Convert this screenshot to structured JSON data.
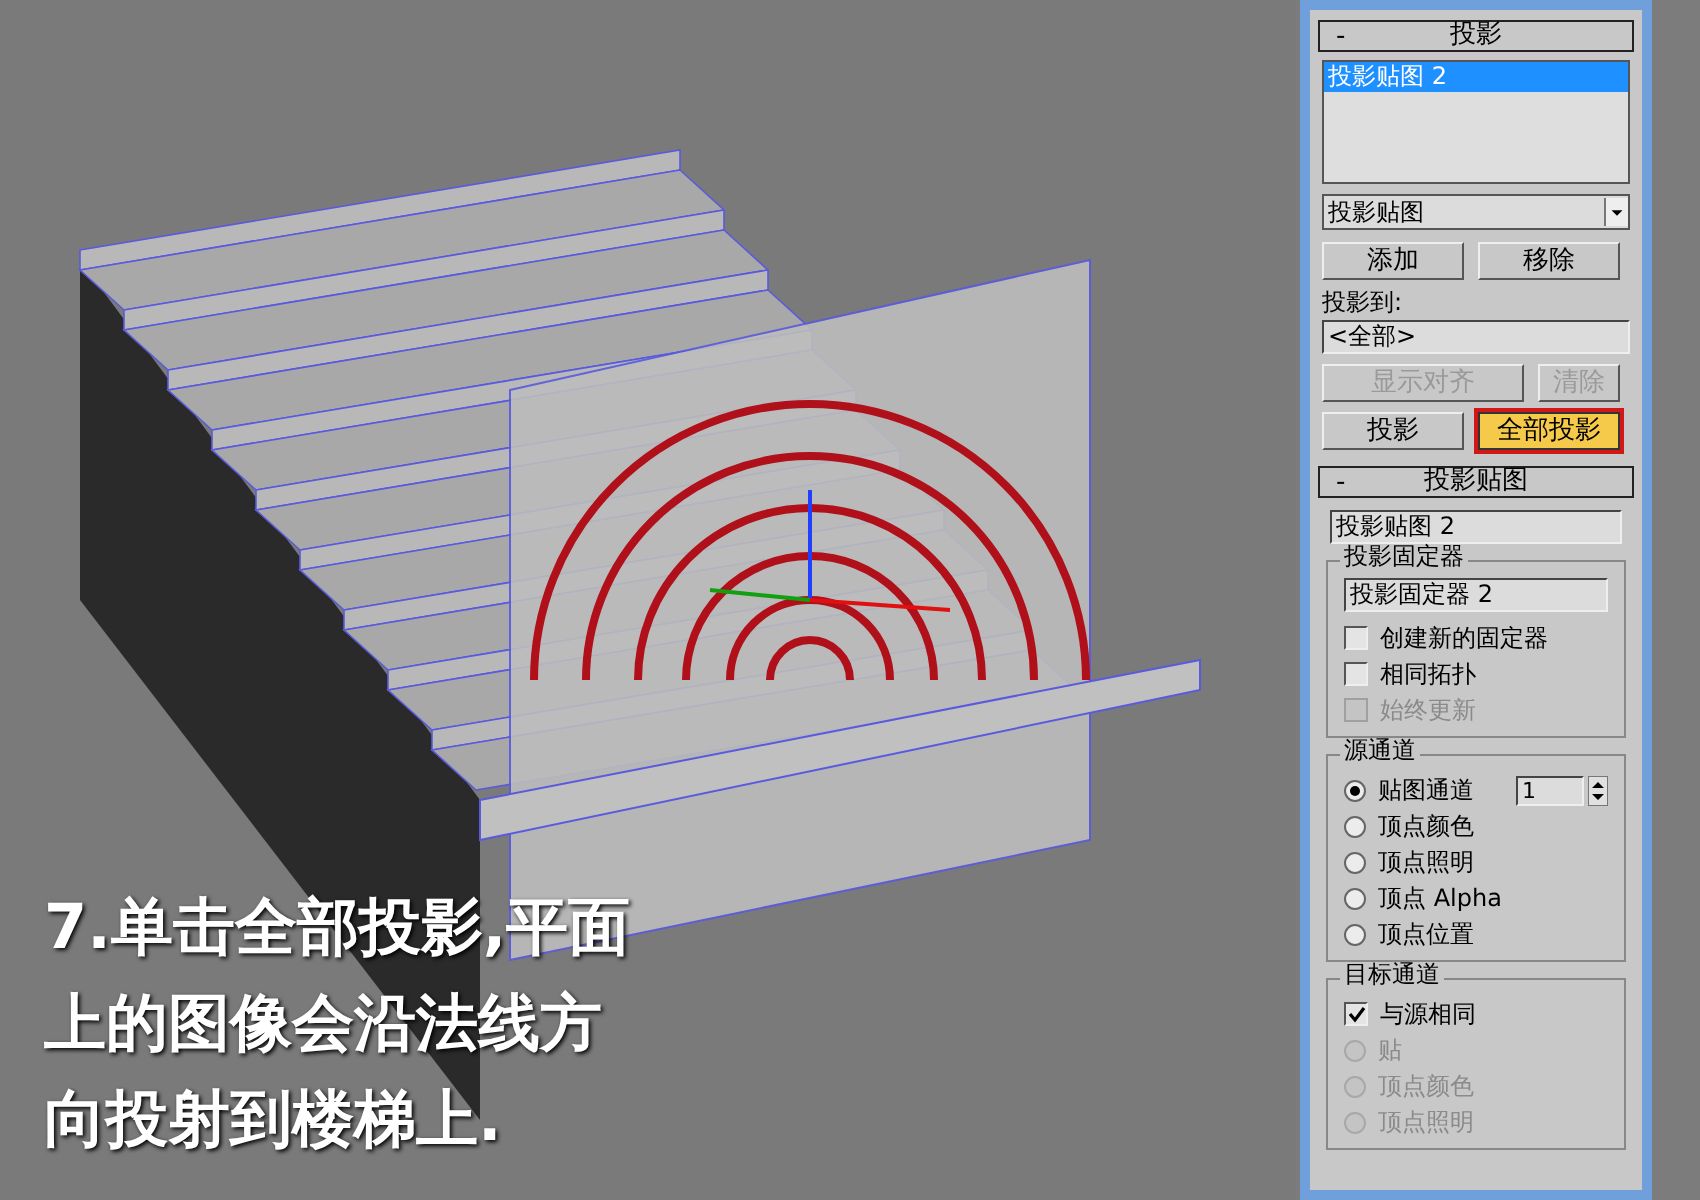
{
  "caption_lines": [
    "7.单击全部投影,平面",
    "上的图像会沿法线方",
    "向投射到楼梯上."
  ],
  "projection_rollout": {
    "title": "投影",
    "collapse": "-",
    "list_items": [
      {
        "label": "投影贴图 2",
        "selected": true
      }
    ],
    "type_dropdown": "投影贴图",
    "buttons": [
      {
        "label": "添加",
        "disabled": false,
        "highlighted": false
      },
      {
        "label": "移除",
        "disabled": false,
        "highlighted": false
      }
    ],
    "project_to_label": "投影到:",
    "project_to_value": "<全部>",
    "buttons_2": [
      {
        "label": "显示对齐",
        "disabled": true,
        "highlighted": false
      },
      {
        "label": "清除",
        "disabled": true,
        "highlighted": false
      }
    ],
    "buttons_3": [
      {
        "label": "投影",
        "disabled": false,
        "highlighted": false
      },
      {
        "label": "全部投影",
        "disabled": false,
        "highlighted": true
      }
    ]
  },
  "projection_map_rollout": {
    "title": "投影贴图",
    "collapse": "-",
    "name_value": "投影贴图 2",
    "holder_group": {
      "title": "投影固定器",
      "name_value": "投影固定器 2",
      "checkboxes": [
        {
          "label": "创建新的固定器",
          "checked": false,
          "disabled": false
        },
        {
          "label": "相同拓扑",
          "checked": false,
          "disabled": false
        },
        {
          "label": "始终更新",
          "checked": false,
          "disabled": true
        }
      ]
    },
    "source_group": {
      "title": "源通道",
      "channel_value": "1",
      "radios": [
        {
          "label": "贴图通道",
          "selected": true,
          "disabled": false
        },
        {
          "label": "顶点颜色",
          "selected": false,
          "disabled": false
        },
        {
          "label": "顶点照明",
          "selected": false,
          "disabled": false
        },
        {
          "label": "顶点 Alpha",
          "selected": false,
          "disabled": false
        },
        {
          "label": "顶点位置",
          "selected": false,
          "disabled": false
        }
      ]
    },
    "target_group": {
      "title": "目标通道",
      "same_as_source": {
        "label": "与源相同",
        "checked": true
      },
      "radios": [
        {
          "label": "贴",
          "selected": false,
          "disabled": true
        },
        {
          "label": "顶点颜色",
          "selected": false,
          "disabled": true
        },
        {
          "label": "顶点照明",
          "selected": false,
          "disabled": true
        }
      ]
    }
  }
}
